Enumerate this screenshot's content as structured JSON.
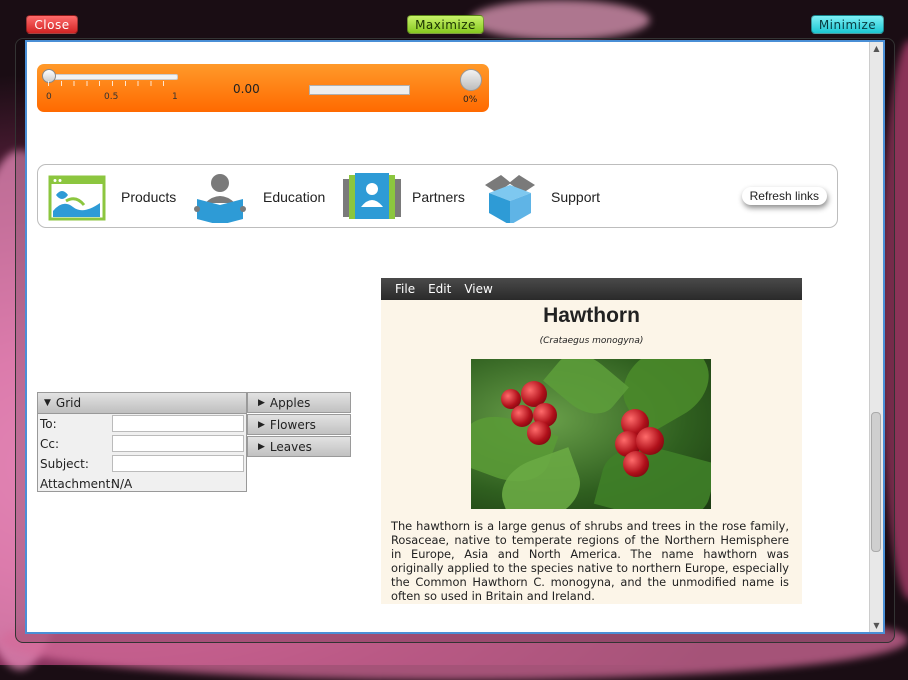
{
  "titlebar": {
    "close_label": "Close",
    "maximize_label": "Maximize",
    "minimize_label": "Minimize"
  },
  "media": {
    "slider_ticks": [
      "0",
      "0.5",
      "1"
    ],
    "time": "0.00",
    "volume": "0%",
    "position": 0.0,
    "progress": 0.0
  },
  "links": {
    "items": [
      {
        "label": "Products",
        "icon": "products-icon"
      },
      {
        "label": "Education",
        "icon": "education-icon"
      },
      {
        "label": "Partners",
        "icon": "partners-icon"
      },
      {
        "label": "Support",
        "icon": "support-icon"
      }
    ],
    "refresh_label": "Refresh links"
  },
  "grid": {
    "title": "Grid",
    "fields": [
      {
        "label": "To:",
        "value": ""
      },
      {
        "label": "Cc:",
        "value": ""
      },
      {
        "label": "Subject:",
        "value": ""
      }
    ],
    "attachment_label": "Attachment:",
    "attachment_value": "N/A"
  },
  "accordion": {
    "items": [
      "Apples",
      "Flowers",
      "Leaves"
    ]
  },
  "browser": {
    "menu": [
      "File",
      "Edit",
      "View"
    ],
    "title": "Hawthorn",
    "subtitle": "(Crataegus monogyna)",
    "body": "The hawthorn is a large genus of shrubs and trees in the rose family, Rosaceae, native to temperate regions of the Northern Hemisphere in Europe, Asia and North America. The name hawthorn was originally applied to the species native to northern Europe, especially the Common Hawthorn C. monogyna, and the unmodified name is often so used in Britain and Ireland."
  },
  "colors": {
    "accent": "#4a8fd6",
    "media_bar": "#ff7a10",
    "close": "#d22424",
    "maximize": "#86c820",
    "minimize": "#1bc6d2"
  }
}
